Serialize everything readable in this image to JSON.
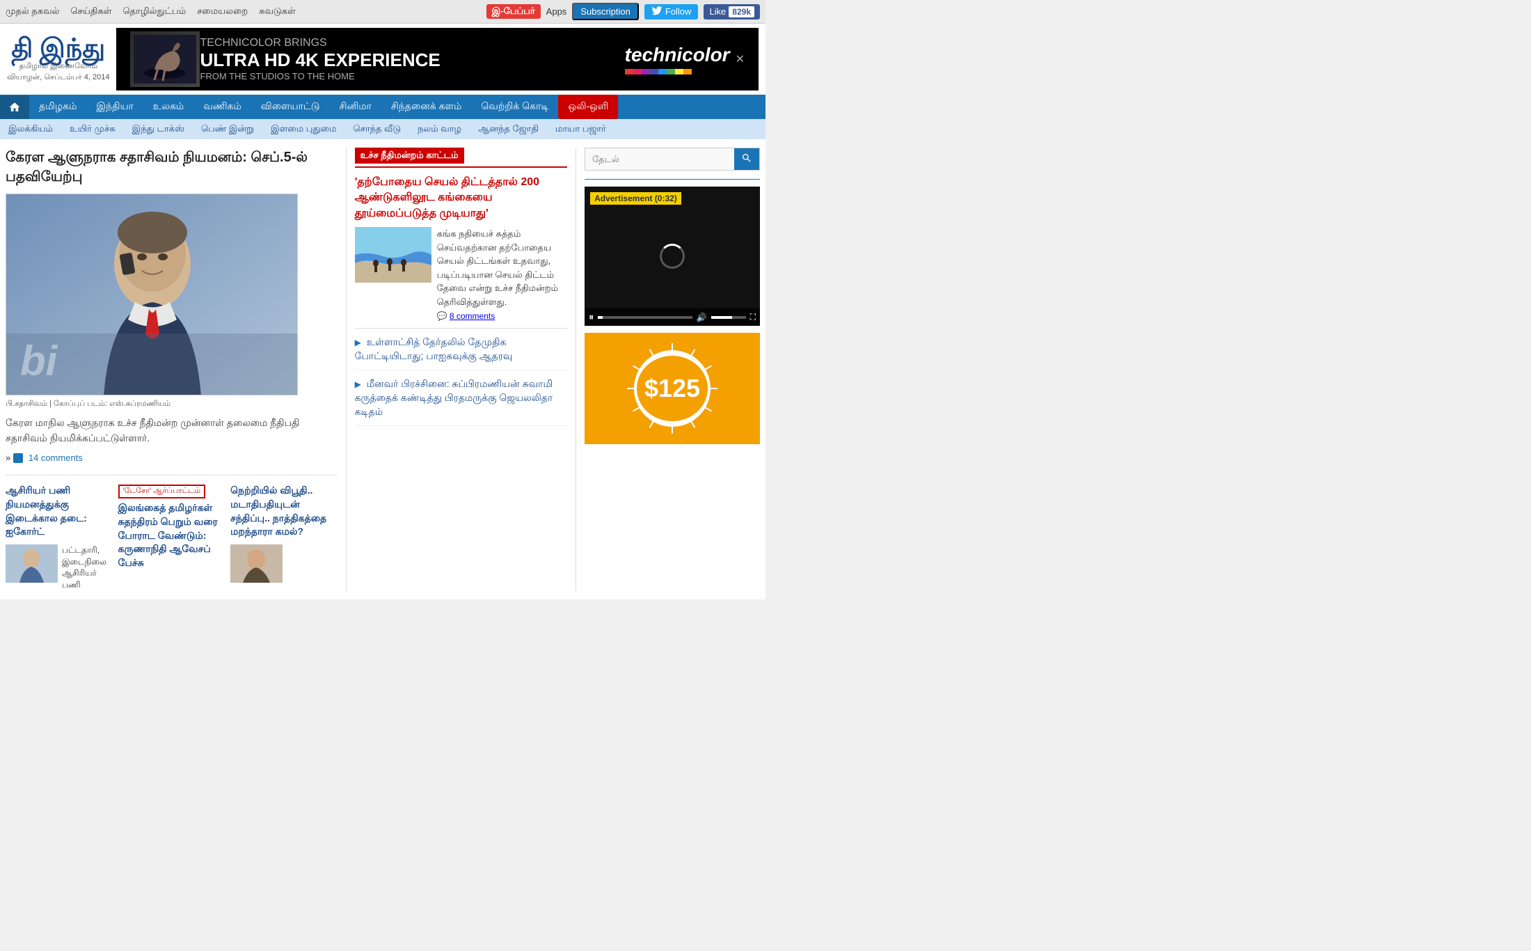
{
  "topbar": {
    "nav_links": [
      "முதல் தகவல்",
      "செய்திகள்",
      "தொழில்நுட்பம்",
      "சமையலறை",
      "சுவடுகள்"
    ],
    "epaper": "இ-பேப்பர்",
    "apps": "Apps",
    "subscription": "Subscription",
    "follow": "Follow",
    "like": "Like",
    "like_count": "829k"
  },
  "header": {
    "logo_main": "தி இந்து",
    "logo_sub": "தமிழால் இணைவோம்",
    "date": "வியாழன், செப்டம்பர் 4, 2014",
    "ad_brings": "TECHNICOLOR BRINGS",
    "ad_ultra": "ULTRA HD 4K EXPERIENCE",
    "ad_from": "FROM THE STUDIOS TO THE HOME",
    "ad_brand": "technicolor"
  },
  "main_nav": {
    "items": [
      "தமிழகம்",
      "இந்தியா",
      "உலகம்",
      "வணிகம்",
      "விளையாட்டு",
      "சினிமா",
      "சிந்தனைக் களம்",
      "வெற்றிக் கொடி",
      "ஒலி-ஒளி"
    ]
  },
  "sub_nav": {
    "items": [
      "இலக்கியம்",
      "உயிர் முச்சு",
      "இந்து டாக்ஸ்",
      "பெண் இன்று",
      "இளமை புதுமை",
      "சொந்த வீடு",
      "நலம் வாழ",
      "ஆனந்த ஜோதி",
      "மாயா பஜார்"
    ]
  },
  "main_article": {
    "headline": "கேரள ஆளுநராக சதாசிவம் நியமனம்: செப்.5-ல் பதவியேற்பு",
    "image_caption": "பி.சதாசிவம் | கோப்புப் படம்: எஸ்.சுப்ரமணியம்",
    "article_text": "கேரள மாநில ஆளுநராக உச்ச நீதிமன்ற முன்னாள் தலைமை நீதிபதி சதாசிவம் நியமிக்கப்பட்டுள்ளார்.",
    "read_more": "»",
    "comment_count": "14 comments"
  },
  "bottom_left": {
    "col1": {
      "headline": "ஆசிரியர் பணி நியமனத்துக்கு இடைக்கால தடை: ஐகோர்ட்",
      "sub_text": "பட்டதாரி, இடைநிலை ஆசிரியர் பணி"
    },
    "col2": {
      "badge": "'டேசோ' ஆர்ப்பாட்டம்",
      "headline": "இலங்கைத் தமிழர்கள் சுதந்திரம் பெறும் வரை போராட வேண்டும்: கருணாநிதி ஆவேசப் பேச்சு"
    },
    "col3": {
      "headline": "நெற்றியில் விபூதி.. மடாதிபதியுடன் சந்திப்பு.. நாத்திகத்தை மறந்தாரா கமல்?"
    }
  },
  "mid_section": {
    "section_badge": "உச்ச நீதிமன்றம் காட்டம்",
    "main_story_title": "'தற்போதைய செயல் திட்டத்தால் 200 ஆண்டுகளிலூட கங்கையை தூய்மைப்படுத்த முடியாது'",
    "story_text": "கங்க நதியைச் சுத்தம் செய்வதற்கான தற்போதைய செயல் திட்டங்கள் உதவாது, படிப்படியான செயல் திட்டம் தேவை என்று உச்ச நீதிமன்றம் தெரிவித்துள்ளது.",
    "story_comments": "8 comments",
    "story2_title": "உள்ளாட்சித் தேர்தலில் தேமுதிக போட்டியிடாது; பாஐகவுக்கு ஆதரவு",
    "story3_title": "மீனவர் பிரச்சினை: சுப்பிரமணியன் சுவாமி கருத்தைக் கண்டித்து பிரதமருக்கு ஜெயலலிதா கடிதம்"
  },
  "right_section": {
    "search_placeholder": "தேடல்",
    "video_ad_label": "Advertisement (0:32)",
    "ad_amount": "$125"
  }
}
